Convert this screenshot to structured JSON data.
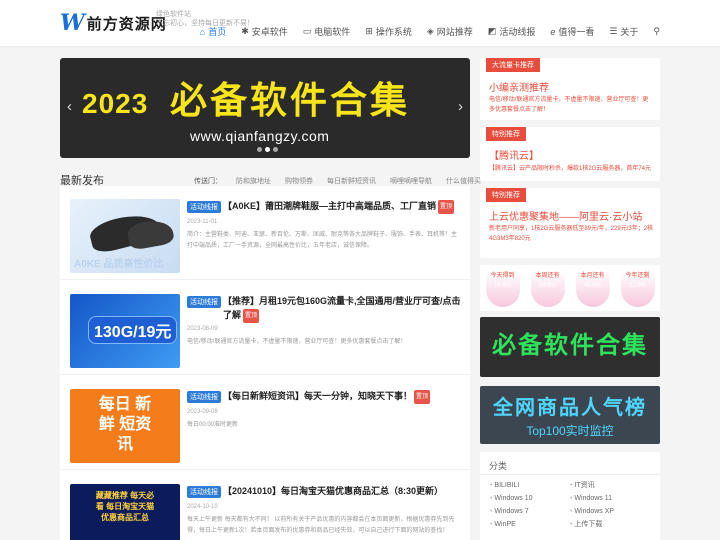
{
  "header": {
    "logo_letter": "W",
    "logo_text": "前方资源网",
    "tagline1": "绿色软件站",
    "tagline2": "不忘初心，坚持每日更新不易！",
    "nav": [
      {
        "icon": "⌂",
        "label": "首页"
      },
      {
        "icon": "✱",
        "label": "安卓软件"
      },
      {
        "icon": "▭",
        "label": "电脑软件"
      },
      {
        "icon": "⊞",
        "label": "操作系统"
      },
      {
        "icon": "◈",
        "label": "网站推荐"
      },
      {
        "icon": "◩",
        "label": "活动线报"
      },
      {
        "icon": "e",
        "label": "值得一看"
      },
      {
        "icon": "☰",
        "label": "关于"
      }
    ],
    "search_icon": "⚲"
  },
  "banner": {
    "year": "2023",
    "title": "必备软件合集",
    "url": "www.qianfangzy.com",
    "prev": "‹",
    "next": "›"
  },
  "section": {
    "title": "最新发布",
    "send_label": "传送门：",
    "links": [
      "防和旗地址",
      "购物领券",
      "每日新鲜短资讯",
      "嘀哩嘀哩导航",
      "什么值得买"
    ]
  },
  "posts": [
    {
      "badge": "活动线报",
      "title": "【A0KE】莆田潮牌鞋服—主打中高端品质、工厂直销",
      "hot": "置顶",
      "date": "2023-11-01",
      "desc": "简介：主营鞋类、阿迪、亚瑟、新百伦、万斯、匡威、耐克等各大品牌鞋子、服饰、手表、耳机等！主打中端品质，工厂一手资源，全网最高性价比，五年老店，诚信保障。",
      "thumb_text": "A0KE 品质高性价比"
    },
    {
      "badge": "活动线报",
      "title": "【推荐】月租19元包160G流量卡,全国通用/营业厅可查/点击了解",
      "hot": "置顶",
      "date": "2023-08-09",
      "desc": "电信/移动/联通官方流量卡，不虚量不限速，营业厅可查！更多优惠套餐点击了解！",
      "thumb_text": "130G/19元"
    },
    {
      "badge": "活动线报",
      "title": "【每日新鲜短资讯】每天一分钟，知晓天下事！",
      "hot": "置顶",
      "date": "2023-09-08",
      "desc": "每日00:00准时更新",
      "thumb_text": "每日 新鲜 短资讯"
    },
    {
      "badge": "活动线报",
      "title": "【20241010】每日淘宝天猫优惠商品汇总（8:30更新）",
      "hot": "",
      "date": "2024-10-10",
      "desc": "每天上午更新 每天都有大不同！ 以前所有关于产品优惠的内容都会在本页面更新，根据优惠券先到先得，每日上午更新1次！若本页面发布的优惠券和商品已经失效，可以自己进行下面的网站的查找！",
      "thumb_text": "藏藏推荐 每天必看 每日淘宝天猫 优惠商品汇总"
    }
  ],
  "sidebar": {
    "card1": {
      "label": "大流量卡推荐",
      "title": "小编亲测推荐",
      "desc": "电信/移动/联通官方流量卡，不虚量不限速，营业厅可查！更多优惠套餐点击了解！"
    },
    "card2": {
      "label": "特别推荐",
      "title": "【腾讯云】",
      "desc": "【腾讯云】云产品限时秒杀，爆款1核2G云服务器，首年74元"
    },
    "card3": {
      "label": "特别推荐",
      "title": "上云优惠聚集地——阿里云·云小站",
      "desc": "新老用户同享，1核2G云服务器低至89元/年，229元/3年；2核4G3M3年820元"
    },
    "bubbles": [
      {
        "name": "今天得到",
        "pct": "74.4%"
      },
      {
        "name": "本周还有",
        "pct": "58.5%"
      },
      {
        "name": "本月还有",
        "pct": "49.5%"
      },
      {
        "name": "今年还剩",
        "pct": "22.6%"
      }
    ],
    "ad1": "必备软件合集",
    "ad2": {
      "a": "全网商品人气榜",
      "b": "Top100实时监控"
    },
    "cats": {
      "title": "分类",
      "items": [
        "BILIBILI",
        "IT资讯",
        "Windows 10",
        "Windows 11",
        "Windows 7",
        "Windows XP",
        "WinPE",
        "上传下载"
      ]
    }
  },
  "colors": {
    "accent": "#2d7bd9",
    "red": "#e74c3c",
    "yellow": "#f7e51a",
    "green": "#2ee35c"
  }
}
